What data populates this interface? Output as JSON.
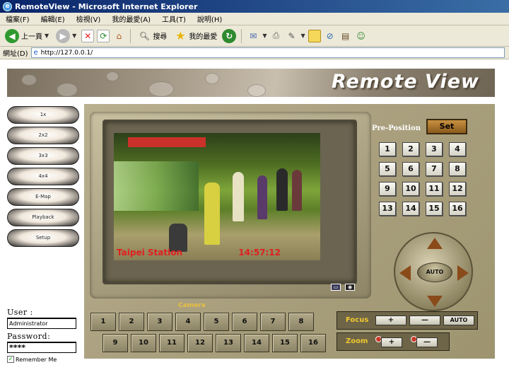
{
  "window": {
    "title": "RemoteView - Microsoft Internet Explorer"
  },
  "menu": [
    "檔案(F)",
    "編輯(E)",
    "檢視(V)",
    "我的最愛(A)",
    "工具(T)",
    "說明(H)"
  ],
  "toolbar": {
    "back_label": "上一頁",
    "search_label": "搜尋",
    "favorites_label": "我的最愛"
  },
  "address": {
    "label": "網址(D)",
    "url": "http://127.0.0.1/"
  },
  "banner": {
    "title": "Remote View"
  },
  "leftnav": [
    "1x",
    "2x2",
    "3x3",
    "4x4",
    "E-Map",
    "Playback",
    "Setup"
  ],
  "login": {
    "user_label": "User :",
    "user_value": "Administrator",
    "password_label": "Password:",
    "password_value": "****",
    "remember_label": "Remember Me"
  },
  "video": {
    "station_text": "Taipei Station",
    "time_text": "14:57:12"
  },
  "preposition": {
    "label": "Pre-Position",
    "set_label": "Set",
    "buttons": [
      "1",
      "2",
      "3",
      "4",
      "5",
      "6",
      "7",
      "8",
      "9",
      "10",
      "11",
      "12",
      "13",
      "14",
      "15",
      "16"
    ]
  },
  "ptz": {
    "auto_label": "AUTO"
  },
  "camera": {
    "label": "Camera",
    "buttons": [
      "1",
      "2",
      "3",
      "4",
      "5",
      "6",
      "7",
      "8",
      "9",
      "10",
      "11",
      "12",
      "13",
      "14",
      "15",
      "16"
    ]
  },
  "focus": {
    "label": "Focus",
    "plus": "+",
    "minus": "—",
    "auto": "AUTO"
  },
  "zoom": {
    "label": "Zoom",
    "plus": "+",
    "minus": "—"
  },
  "colors": {
    "titlebar": "#0a246a",
    "accent_gold": "#f0c830",
    "panel": "#aca281",
    "caption_red": "#e02020"
  }
}
